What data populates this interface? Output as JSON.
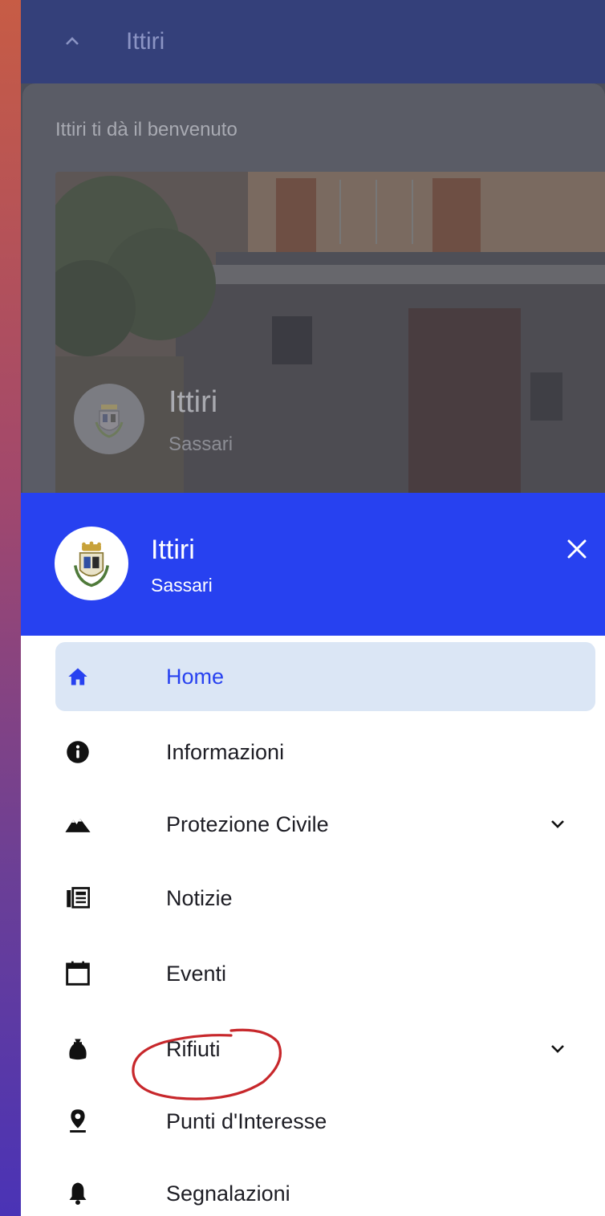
{
  "app_bar": {
    "title": "Ittiri"
  },
  "welcome": {
    "text": "Ittiri ti dà il benvenuto"
  },
  "hero": {
    "title": "Ittiri",
    "subtitle": "Sassari"
  },
  "drawer": {
    "header": {
      "title": "Ittiri",
      "subtitle": "Sassari"
    },
    "items": [
      {
        "label": "Home",
        "icon": "home-icon",
        "active": true,
        "expandable": false
      },
      {
        "label": "Informazioni",
        "icon": "info-icon",
        "active": false,
        "expandable": false
      },
      {
        "label": "Protezione Civile",
        "icon": "mountain-icon",
        "active": false,
        "expandable": true
      },
      {
        "label": "Notizie",
        "icon": "newspaper-icon",
        "active": false,
        "expandable": false
      },
      {
        "label": "Eventi",
        "icon": "calendar-icon",
        "active": false,
        "expandable": false
      },
      {
        "label": "Rifiuti",
        "icon": "trash-bag-icon",
        "active": false,
        "expandable": true
      },
      {
        "label": "Punti d'Interesse",
        "icon": "map-pin-icon",
        "active": false,
        "expandable": false
      },
      {
        "label": "Segnalazioni",
        "icon": "bell-icon",
        "active": false,
        "expandable": false
      }
    ]
  },
  "colors": {
    "drawer_header": "#2741f0",
    "active_item_bg": "#dbe6f5",
    "active_item_text": "#2741f0",
    "annotation": "#c7272b"
  }
}
